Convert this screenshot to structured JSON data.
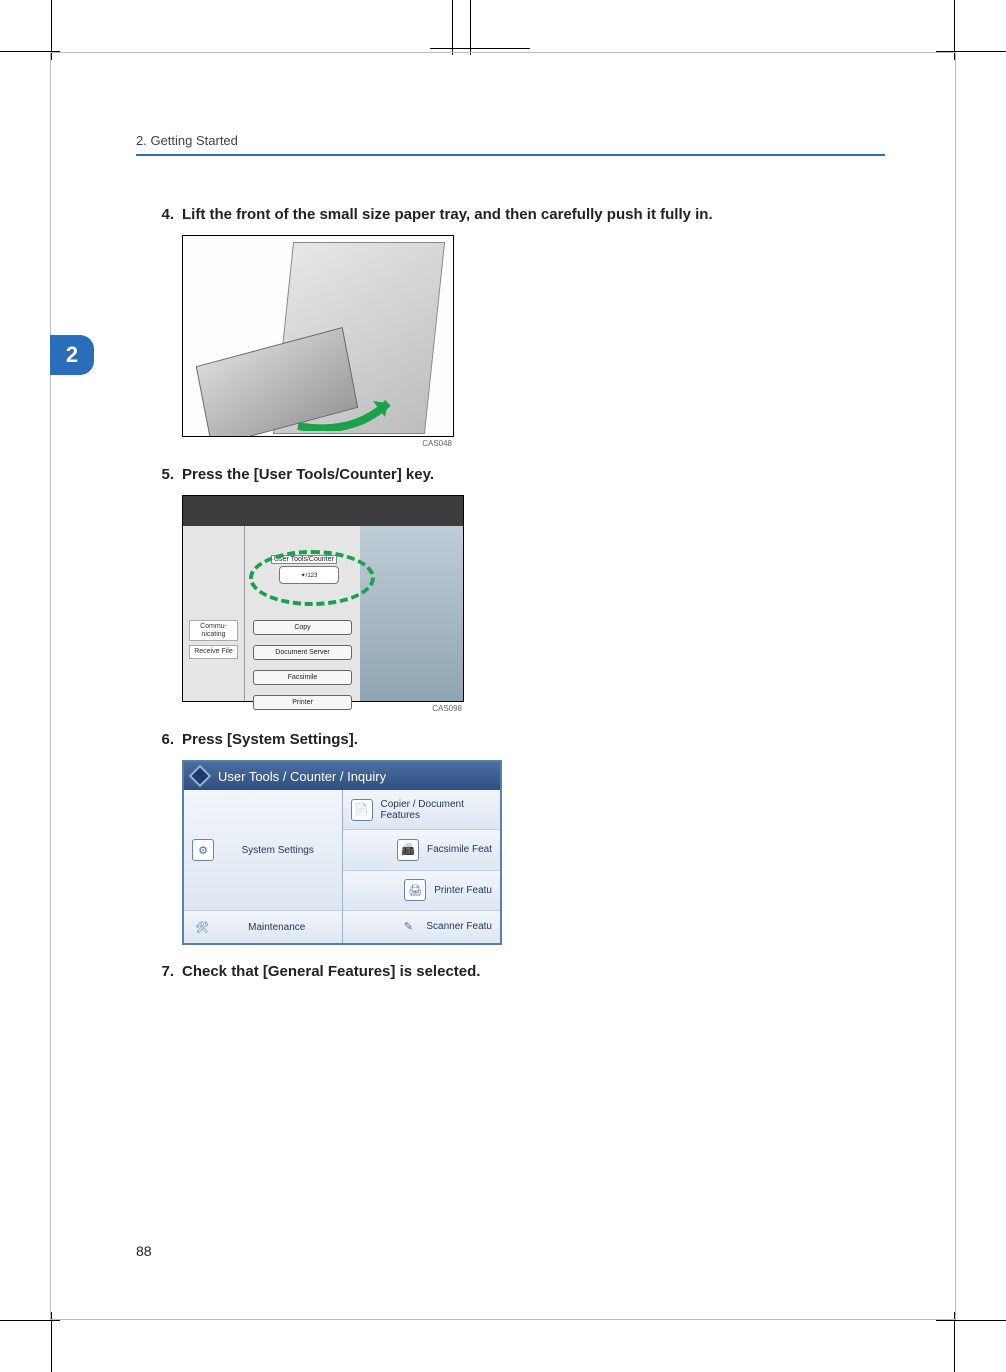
{
  "running_head": "2. Getting Started",
  "chapter_tab": "2",
  "page_number": "88",
  "steps": [
    {
      "num": "4.",
      "text": "Lift the front of the small size paper tray, and then carefully push it fully in.",
      "fig_caption": "CAS048"
    },
    {
      "num": "5.",
      "text": "Press the [User Tools/Counter] key.",
      "fig_caption": "CAS098",
      "panel": {
        "left_labels": [
          "Commu-\nnicating",
          "Receive File"
        ],
        "key_label_top": "User Tools/Counter",
        "key_label_icon": "✦/123",
        "buttons": [
          "Copy",
          "Document Server",
          "Facsimile",
          "Printer"
        ]
      }
    },
    {
      "num": "6.",
      "text": "Press [System Settings].",
      "ui": {
        "title": "User Tools / Counter / Inquiry",
        "left_tiles": [
          "System Settings",
          "Maintenance"
        ],
        "right_tiles": [
          "Copier / Document Features",
          "Facsimile Feat",
          "Printer Featu",
          "Scanner Featu"
        ]
      }
    },
    {
      "num": "7.",
      "text": "Check that [General Features] is selected."
    }
  ]
}
